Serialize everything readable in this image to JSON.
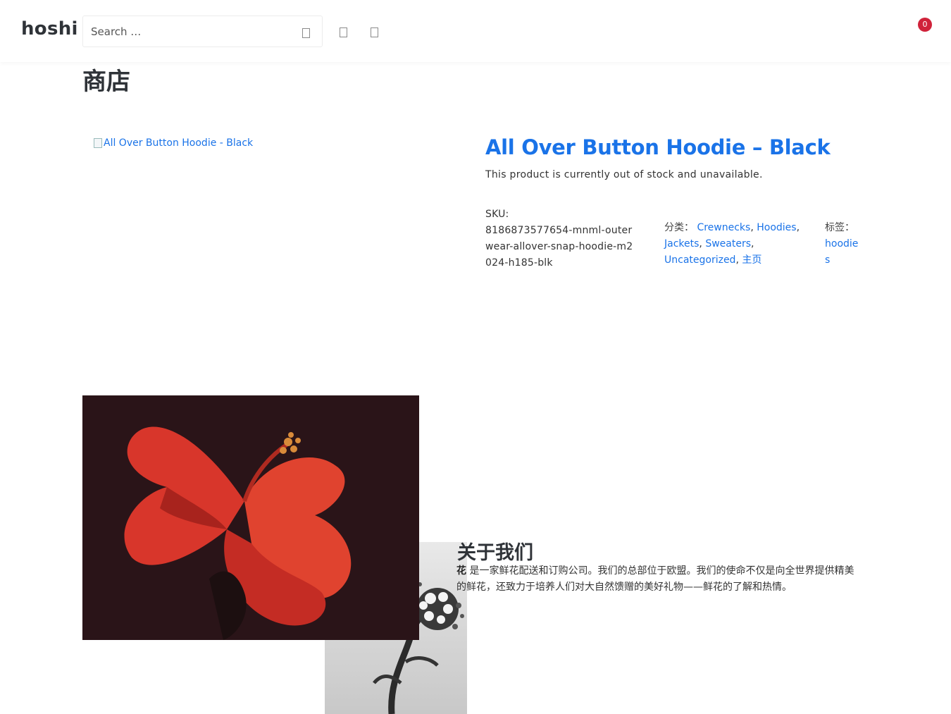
{
  "header": {
    "brand": "hoshi",
    "search": {
      "placeholder": "Search …",
      "value": ""
    },
    "cart_count": "0"
  },
  "page": {
    "title": "商店"
  },
  "product": {
    "image_alt": "All Over Button Hoodie - Black",
    "title": "All Over Button Hoodie – Black",
    "stock_note": "This product is currently out of stock and unavailable.",
    "sku_label": "SKU:",
    "sku": "8186873577654-mnml-outerwear-allover-snap-hoodie-m2024-h185-blk",
    "categories_label": "分类：",
    "categories": [
      "Crewnecks",
      "Hoodies",
      "Jackets",
      "Sweaters",
      "Uncategorized",
      "主页"
    ],
    "tags_label": "标签：",
    "tags": [
      "hoodies"
    ]
  },
  "about": {
    "title": "关于我们",
    "brand_word": "花",
    "text": " 是一家鲜花配送和订购公司。我们的总部位于欧盟。我们的使命不仅是向全世界提供精美的鲜花，还致力于培养人们对大自然馈赠的美好礼物——鲜花的了解和热情。"
  },
  "colors": {
    "link": "#1a73e8",
    "heading": "#2f3338",
    "badge": "#d0223a"
  }
}
